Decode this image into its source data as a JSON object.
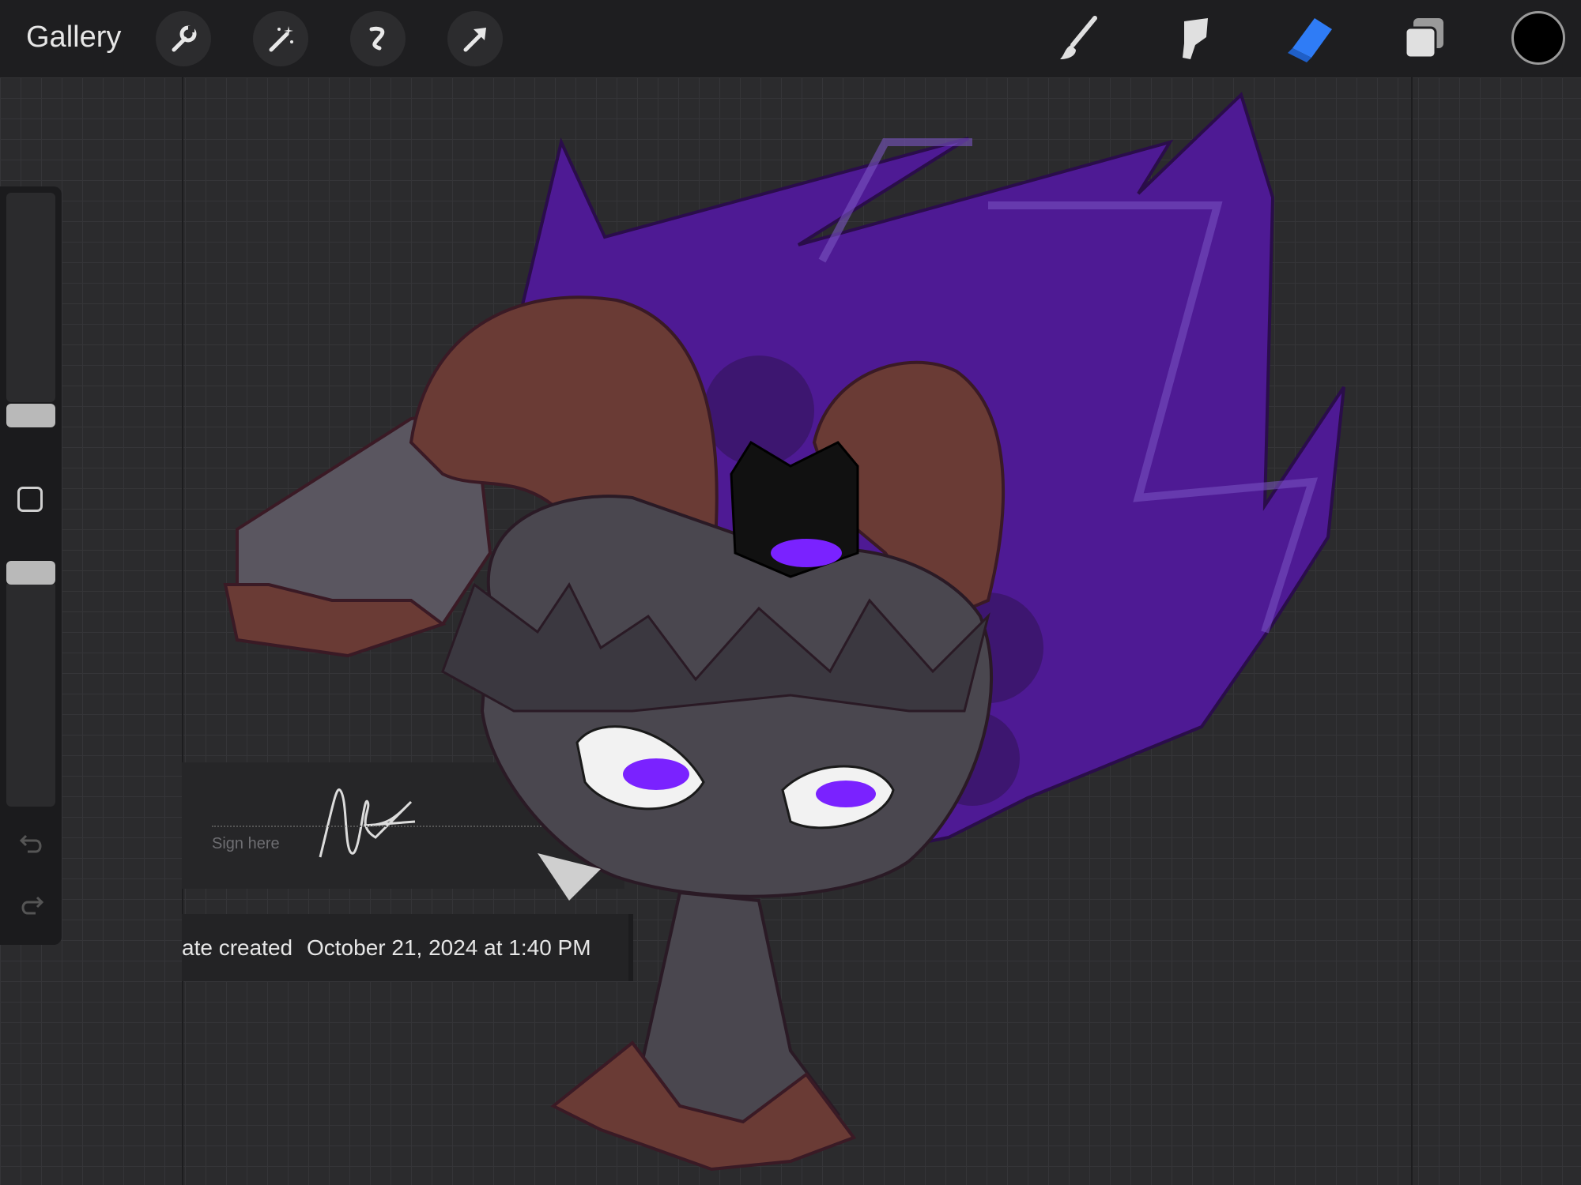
{
  "app": {
    "gallery_label": "Gallery"
  },
  "toolbar": {
    "left_tools": [
      "wrench-icon",
      "magic-wand-icon",
      "selection-icon",
      "transform-arrow-icon"
    ],
    "right_tools": [
      "brush-icon",
      "smudge-icon",
      "eraser-icon",
      "layers-icon"
    ],
    "active_tool": "eraser",
    "accent_color": "#2f7cf6",
    "current_color": "#000000"
  },
  "sidebar": {
    "controls": [
      "brush-size-slider",
      "modify-button",
      "opacity-slider",
      "undo-icon",
      "redo-icon"
    ]
  },
  "signature": {
    "placeholder": "Sign here"
  },
  "info": {
    "date_label": "ate created",
    "date_value": "October 21, 2024 at 1:40 PM"
  },
  "artwork": {
    "subject": "purple-maned horned pony character illustration",
    "colors": {
      "mane": "#4e1a94",
      "horns": "#6a3b35",
      "body": "#4a474f",
      "eye": "#7a22ff"
    }
  }
}
